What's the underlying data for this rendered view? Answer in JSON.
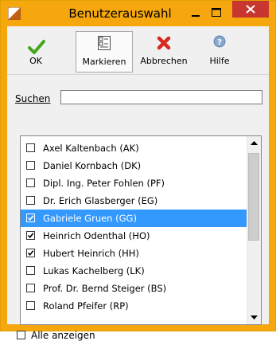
{
  "window": {
    "title": "Benutzerauswahl",
    "accent_color": "#f5a70d",
    "close_color": "#c7372f"
  },
  "toolbar": {
    "buttons": [
      {
        "label": "OK",
        "icon": "checkmark-icon"
      },
      {
        "label": "Markieren",
        "icon": "mark-list-icon"
      },
      {
        "label": "Abbrechen",
        "icon": "x-icon"
      },
      {
        "label": "Hilfe",
        "icon": "help-icon"
      }
    ]
  },
  "search": {
    "label": "Suchen",
    "value": ""
  },
  "users": [
    {
      "label": "Axel Kaltenbach (AK)",
      "checked": false,
      "selected": false
    },
    {
      "label": "Daniel Kornbach (DK)",
      "checked": false,
      "selected": false
    },
    {
      "label": "Dipl. Ing. Peter Fohlen (PF)",
      "checked": false,
      "selected": false
    },
    {
      "label": "Dr. Erich Glasberger (EG)",
      "checked": false,
      "selected": false
    },
    {
      "label": "Gabriele Gruen (GG)",
      "checked": true,
      "selected": true
    },
    {
      "label": "Heinrich Odenthal (HO)",
      "checked": true,
      "selected": false
    },
    {
      "label": "Hubert Heinrich (HH)",
      "checked": true,
      "selected": false
    },
    {
      "label": "Lukas Kachelberg (LK)",
      "checked": false,
      "selected": false
    },
    {
      "label": "Prof. Dr. Bernd Steiger (BS)",
      "checked": false,
      "selected": false
    },
    {
      "label": "Roland Pfeifer (RP)",
      "checked": false,
      "selected": false
    }
  ],
  "show_all": {
    "label": "Alle anzeigen",
    "checked": false
  }
}
